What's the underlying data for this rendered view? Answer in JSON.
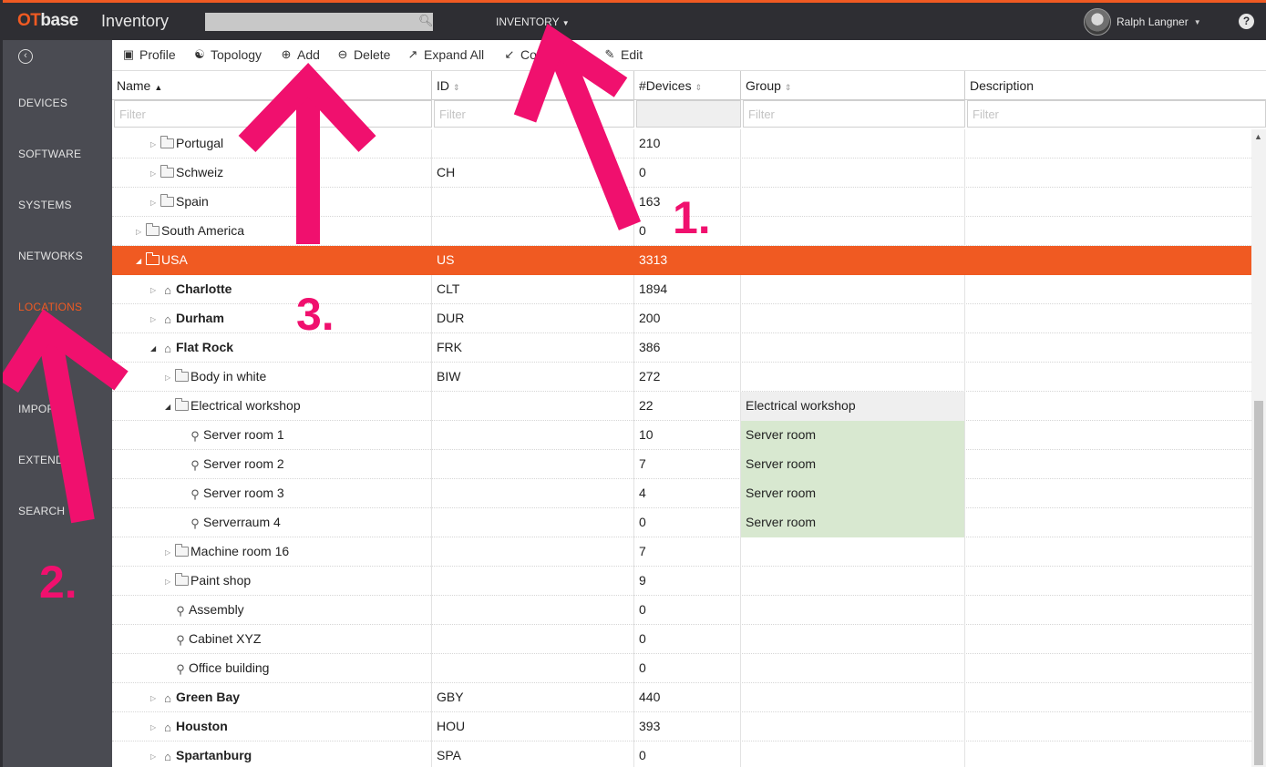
{
  "topbar": {
    "brand_ot": "OT",
    "brand_base": "base",
    "app_title": "Inventory",
    "search_placeholder": "",
    "menu_label": "INVENTORY",
    "user_name": "Ralph Langner",
    "help": "?"
  },
  "sidebar": {
    "items": [
      {
        "label": "DEVICES"
      },
      {
        "label": "SOFTWARE"
      },
      {
        "label": "SYSTEMS"
      },
      {
        "label": "NETWORKS"
      },
      {
        "label": "LOCATIONS"
      },
      {
        "label": "IMPORT"
      },
      {
        "label": "EXTEND"
      },
      {
        "label": "SEARCH"
      }
    ],
    "active": "LOCATIONS"
  },
  "toolbar": {
    "profile": "Profile",
    "topology": "Topology",
    "add": "Add",
    "delete": "Delete",
    "expand_all": "Expand All",
    "collapse_all": "Collapse All",
    "edit": "Edit"
  },
  "grid": {
    "columns": {
      "name": "Name",
      "id": "ID",
      "devices": "#Devices",
      "group": "Group",
      "description": "Description"
    },
    "filter_placeholder": "Filter",
    "rows": [
      {
        "name": "Portugal",
        "id": "",
        "devices": "210",
        "group": "",
        "description": ""
      },
      {
        "name": "Schweiz",
        "id": "CH",
        "devices": "0",
        "group": "",
        "description": ""
      },
      {
        "name": "Spain",
        "id": "",
        "devices": "163",
        "group": "",
        "description": ""
      },
      {
        "name": "South America",
        "id": "",
        "devices": "0",
        "group": "",
        "description": ""
      },
      {
        "name": "USA",
        "id": "US",
        "devices": "3313",
        "group": "",
        "description": ""
      },
      {
        "name": "Charlotte",
        "id": "CLT",
        "devices": "1894",
        "group": "",
        "description": ""
      },
      {
        "name": "Durham",
        "id": "DUR",
        "devices": "200",
        "group": "",
        "description": ""
      },
      {
        "name": "Flat Rock",
        "id": "FRK",
        "devices": "386",
        "group": "",
        "description": ""
      },
      {
        "name": "Body in white",
        "id": "BIW",
        "devices": "272",
        "group": "",
        "description": ""
      },
      {
        "name": "Electrical workshop",
        "id": "",
        "devices": "22",
        "group": "Electrical workshop",
        "description": ""
      },
      {
        "name": "Server room 1",
        "id": "",
        "devices": "10",
        "group": "Server room",
        "description": ""
      },
      {
        "name": "Server room 2",
        "id": "",
        "devices": "7",
        "group": "Server room",
        "description": ""
      },
      {
        "name": "Server room 3",
        "id": "",
        "devices": "4",
        "group": "Server room",
        "description": ""
      },
      {
        "name": "Serverraum 4",
        "id": "",
        "devices": "0",
        "group": "Server room",
        "description": ""
      },
      {
        "name": "Machine room 16",
        "id": "",
        "devices": "7",
        "group": "",
        "description": ""
      },
      {
        "name": "Paint shop",
        "id": "",
        "devices": "9",
        "group": "",
        "description": ""
      },
      {
        "name": "Assembly",
        "id": "",
        "devices": "0",
        "group": "",
        "description": ""
      },
      {
        "name": "Cabinet XYZ",
        "id": "",
        "devices": "0",
        "group": "",
        "description": ""
      },
      {
        "name": "Office building",
        "id": "",
        "devices": "0",
        "group": "",
        "description": ""
      },
      {
        "name": "Green Bay",
        "id": "GBY",
        "devices": "440",
        "group": "",
        "description": ""
      },
      {
        "name": "Houston",
        "id": "HOU",
        "devices": "393",
        "group": "",
        "description": ""
      },
      {
        "name": "Spartanburg",
        "id": "SPA",
        "devices": "0",
        "group": "",
        "description": ""
      }
    ],
    "selected_row": "USA"
  },
  "annotations": {
    "step1": "1.",
    "step2": "2.",
    "step3": "3."
  },
  "colors": {
    "accent": "#f05a22",
    "topbar": "#2e2e33",
    "sidebar": "#4a4b52",
    "annotation": "#f0106e",
    "group_highlight": "#d8e8d0"
  }
}
